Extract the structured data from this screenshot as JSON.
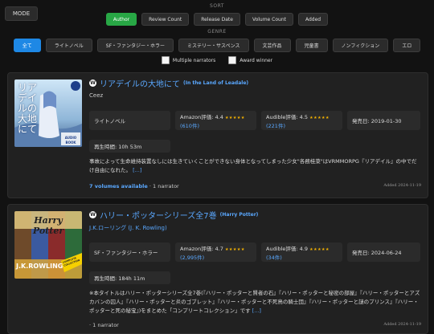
{
  "mode_label": "MODE",
  "sort": {
    "label": "SORT",
    "options": [
      "Author",
      "Review Count",
      "Release Date",
      "Volume Count",
      "Added"
    ],
    "active": "Author"
  },
  "genre": {
    "label": "GENRE",
    "options": [
      "全て",
      "ライトノベル",
      "SF・ファンタジー・ホラー",
      "ミステリー・サスペンス",
      "文芸作品",
      "児童書",
      "ノンフィクション",
      "エロ"
    ],
    "active": "全て"
  },
  "filters": {
    "multiple_narrators": "Multiple narrators",
    "award_winner": "Award winner"
  },
  "colors": {
    "accent_blue": "#1e88e5",
    "accent_green": "#28a745",
    "link": "#5aa8ff",
    "star": "#f5b301"
  },
  "books": [
    {
      "title": "リアデイルの大地にて",
      "subtitle": "(In the Land of Leadale)",
      "author": "Ceez",
      "genre": "ライトノベル",
      "amazon_rating": "Amazon評価: 4.4",
      "amazon_reviews": "(610件)",
      "audible_rating": "Audible評価: 4.5",
      "audible_reviews": "(221件)",
      "release": "発売日: 2019-01-30",
      "duration": "再生時間: 10h 53m",
      "description": "事故によって生命維持装置なしには生きていくことができない身体となってしまった少女\"各務桂菜\"はVRMMORPG『リアデイル』の中でだけ自由になれた。",
      "more": "[...]",
      "volumes": "7 volumes available",
      "narrators": " · 1 narrator",
      "added": "Added 2024-11-19",
      "cover": {
        "title_vertical": "リアデイルの大地にて",
        "badge": "AUDIO BOOK"
      }
    },
    {
      "title": "ハリー・ポッターシリーズ全7巻",
      "subtitle": "(Harry Potter)",
      "author": "J.K.ローリング (J. K. Rowling)",
      "genre": "SF・ファンタジー・ホラー",
      "amazon_rating": "Amazon評価: 4.7",
      "amazon_reviews": "(2,995件)",
      "audible_rating": "Audible評価: 4.9",
      "audible_reviews": "(34件)",
      "release": "発売日: 2024-06-24",
      "duration": "再生時間: 184h 11m",
      "description": "※本タイトルはハリー・ポッターシリーズ全7巻(『ハリー・ポッターと賢者の石』『ハリー・ポッターと秘密の部屋』『ハリー・ポッターとアズカバンの囚人』『ハリー・ポッターと炎のゴブレット』『ハリー・ポッターと不死鳥の騎士団』『ハリー・ポッターと謎のプリンス』『ハリー・ポッターと死の秘宝』)をまとめた「コンプリートコレクション」です",
      "more": "[...]",
      "volumes": "",
      "narrators": " · 1 narrator",
      "added": "Added 2024-11-19",
      "cover": {
        "title_text": "Harry Potter",
        "author_text": "J.K.ROWLING",
        "badge": "COMPLETE COLLECTION"
      }
    }
  ]
}
